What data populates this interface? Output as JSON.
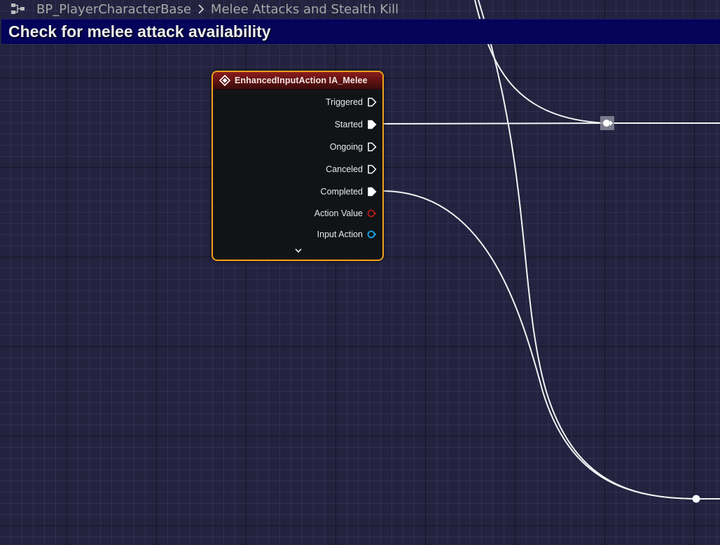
{
  "breadcrumb": {
    "icon": "graph-icon",
    "blueprint": "BP_PlayerCharacterBase",
    "graph": "Melee Attacks and Stealth Kill"
  },
  "comment": {
    "text": "Check for melee attack availability",
    "color": "#04045a"
  },
  "node": {
    "title": "EnhancedInputAction IA_Melee",
    "header_color": "#8a1d1d",
    "selected_outline_color": "#f2a11a",
    "pins": [
      {
        "label": "Triggered",
        "type": "exec",
        "connected": false
      },
      {
        "label": "Started",
        "type": "exec",
        "connected": true
      },
      {
        "label": "Ongoing",
        "type": "exec",
        "connected": false
      },
      {
        "label": "Canceled",
        "type": "exec",
        "connected": false
      },
      {
        "label": "Completed",
        "type": "exec",
        "connected": true
      },
      {
        "label": "Action Value",
        "type": "struct",
        "color": "#b01818",
        "connected": false
      },
      {
        "label": "Input Action",
        "type": "object",
        "color": "#1aa6e8",
        "connected": false
      }
    ],
    "expand_icon": "chevron-down-icon"
  },
  "colors": {
    "graph_background": "#23233f",
    "wire": "#f2f2f2"
  }
}
